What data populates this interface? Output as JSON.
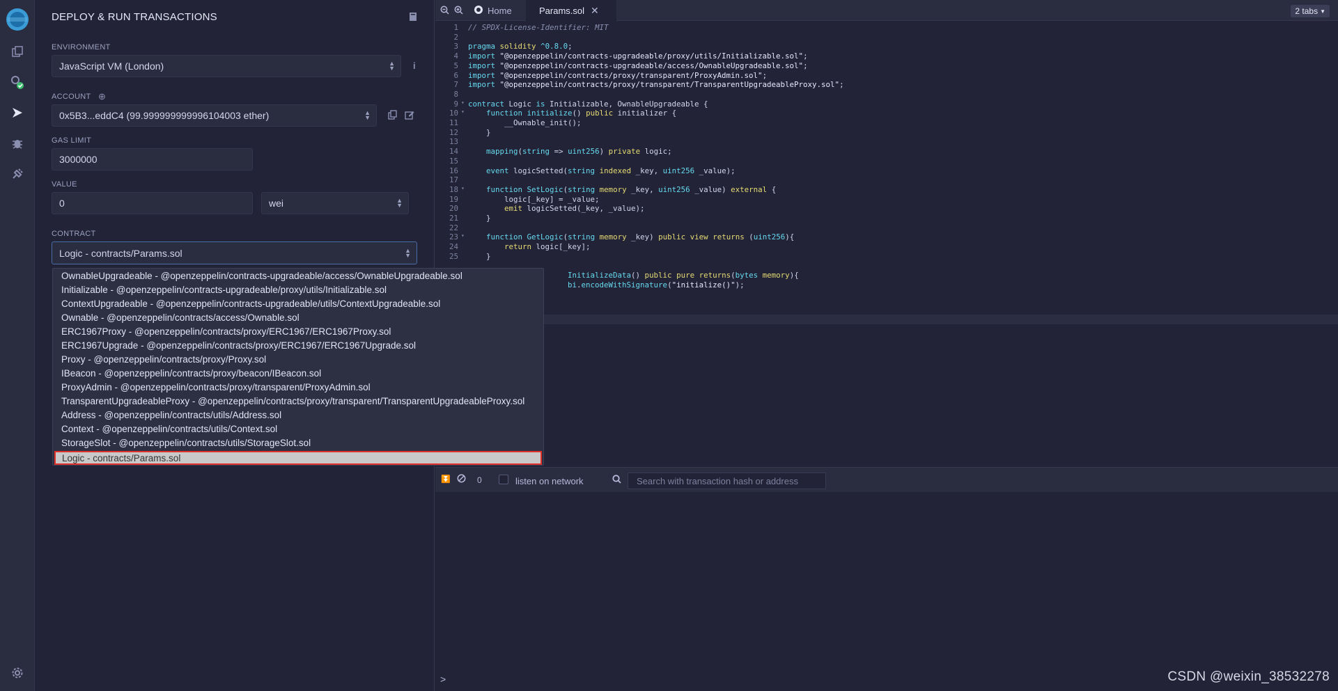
{
  "panel": {
    "title": "DEPLOY & RUN TRANSACTIONS",
    "environment_label": "ENVIRONMENT",
    "environment_value": "JavaScript VM (London)",
    "account_label": "ACCOUNT",
    "account_value": "0x5B3...eddC4 (99.999999999996104003 ether)",
    "gas_limit_label": "GAS LIMIT",
    "gas_limit_value": "3000000",
    "value_label": "VALUE",
    "value_amount": "0",
    "value_unit": "wei",
    "contract_label": "CONTRACT",
    "contract_value": "Logic - contracts/Params.sol"
  },
  "dropdown": {
    "options": [
      "OwnableUpgradeable - @openzeppelin/contracts-upgradeable/access/OwnableUpgradeable.sol",
      "Initializable - @openzeppelin/contracts-upgradeable/proxy/utils/Initializable.sol",
      "ContextUpgradeable - @openzeppelin/contracts-upgradeable/utils/ContextUpgradeable.sol",
      "Ownable - @openzeppelin/contracts/access/Ownable.sol",
      "ERC1967Proxy - @openzeppelin/contracts/proxy/ERC1967/ERC1967Proxy.sol",
      "ERC1967Upgrade - @openzeppelin/contracts/proxy/ERC1967/ERC1967Upgrade.sol",
      "Proxy - @openzeppelin/contracts/proxy/Proxy.sol",
      "IBeacon - @openzeppelin/contracts/proxy/beacon/IBeacon.sol",
      "ProxyAdmin - @openzeppelin/contracts/proxy/transparent/ProxyAdmin.sol",
      "TransparentUpgradeableProxy - @openzeppelin/contracts/proxy/transparent/TransparentUpgradeableProxy.sol",
      "Address - @openzeppelin/contracts/utils/Address.sol",
      "Context - @openzeppelin/contracts/utils/Context.sol",
      "StorageSlot - @openzeppelin/contracts/utils/StorageSlot.sol"
    ],
    "selected": "Logic - contracts/Params.sol"
  },
  "editor": {
    "tab_home": "Home",
    "tab_active": "Params.sol",
    "tabs_count": "2 tabs",
    "line_numbers": [
      "1",
      "2",
      "3",
      "4",
      "5",
      "6",
      "7",
      "8",
      "9",
      "10",
      "11",
      "12",
      "13",
      "14",
      "15",
      "16",
      "17",
      "18",
      "19",
      "20",
      "21",
      "22",
      "23",
      "24",
      "25"
    ]
  },
  "terminal": {
    "count": "0",
    "listen_label": "listen on network",
    "search_placeholder": "Search with transaction hash or address",
    "prompt": ">"
  },
  "watermark": "CSDN @weixin_38532278"
}
